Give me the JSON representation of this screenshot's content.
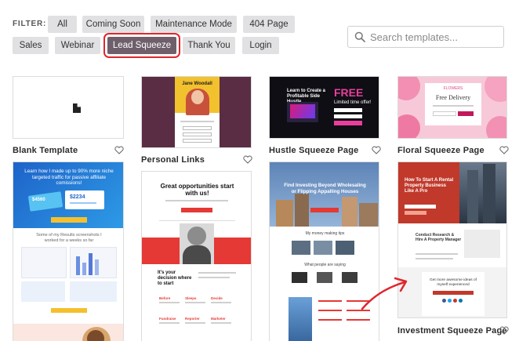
{
  "filter": {
    "label": "FILTER:",
    "chips": [
      "All",
      "Coming Soon",
      "Maintenance Mode",
      "404 Page",
      "Sales",
      "Webinar",
      "Lead Squeeze",
      "Thank You",
      "Login"
    ],
    "active": "Lead Squeeze"
  },
  "search": {
    "placeholder": "Search templates..."
  },
  "templates": {
    "blank": {
      "title": "Blank Template"
    },
    "personal": {
      "title": "Personal Links",
      "preview_name": "Jane Woodall"
    },
    "hustle": {
      "title": "Hustle Squeeze Page",
      "preview_heading": "Learn to Create a Profitable Side Hustle",
      "preview_badge": "FREE",
      "preview_sub": "Limited time offer!"
    },
    "floral": {
      "title": "Floral Squeeze Page",
      "preview_brand": "FLOWERS",
      "preview_offer": "Free Delivery"
    },
    "affiliate": {
      "preview_heading": "Learn how I made up to 90% more niche targeted traffic for passive affiliate comissions!",
      "preview_amount1": "$2234",
      "preview_amount2": "$4560",
      "preview_text": "Some of my Results screenshots I worked for a weeks so far"
    },
    "opportunities": {
      "preview_heading": "Great opportunities start with us!",
      "preview_sub": "It's your decision where to start",
      "preview_labels": [
        "Before",
        "Sleeps",
        "Decide",
        "Fundraise",
        "Reporter",
        "Marketer"
      ]
    },
    "investing": {
      "preview_heading": "Find Investing Beyond Wholesaling or Flipping Appalling Houses",
      "preview_sub1": "My money making tips",
      "preview_sub2": "What people are saying"
    },
    "investment": {
      "title": "Investment Squeeze Page",
      "preview_heading": "How To Start A Rental Property Business Like A Pro",
      "preview_sub": "Conduct Research & Hire A Property Manager",
      "preview_offer": "Get more awesome ideas of myself experienced"
    }
  },
  "colors": {
    "chip_bg": "#e1e1e4",
    "active_chip_bg": "#6e5f6b",
    "highlight_red": "#e0262d",
    "arrow_red": "#e0262d"
  },
  "icons": [
    "search-icon",
    "document-icon",
    "heart-icon",
    "arrow-annotation-icon"
  ]
}
